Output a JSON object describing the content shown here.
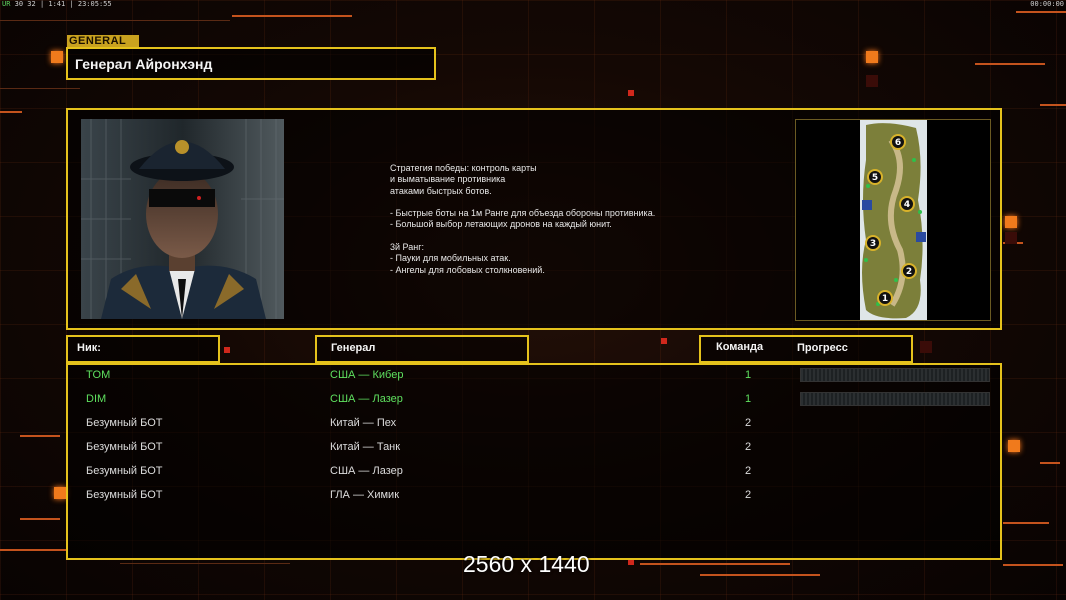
{
  "hud": {
    "top_left_ur": "UR",
    "top_left_rest": "30 32 | 1:41 | 23:05:55",
    "top_right": "00:00:00"
  },
  "general": {
    "tag": "GENERAL",
    "name": "Генерал Айронхэнд",
    "portrait_icon": "general-portrait",
    "description": [
      "Стратегия победы: контроль карты",
      "и выматывание противника",
      "атаками быстрых ботов.",
      "",
      "- Быстрые боты на 1м Ранге для объезда обороны противника.",
      "- Большой выбор летающих дронов на каждый юнит.",
      "",
      "3й Ранг:",
      "- Пауки для мобильных атак.",
      "- Ангелы для лобовых столкновений."
    ],
    "map_slots": [
      "6",
      "5",
      "4",
      "3",
      "2",
      "1"
    ]
  },
  "table": {
    "headers": {
      "nick": "Ник:",
      "general": "Генерал",
      "team": "Команда",
      "progress": "Прогресс"
    },
    "rows": [
      {
        "nick": "TOM",
        "general": "США — Кибер",
        "team": "1"
      },
      {
        "nick": "DIM",
        "general": "США — Лазер",
        "team": "1"
      },
      {
        "nick": "Безумный БОТ",
        "general": "Китай — Пех",
        "team": "2"
      },
      {
        "nick": "Безумный БОТ",
        "general": "Китай — Танк",
        "team": "2"
      },
      {
        "nick": "Безумный БОТ",
        "general": "США — Лазер",
        "team": "2"
      },
      {
        "nick": "Безумный БОТ",
        "general": "ГЛА — Химик",
        "team": "2"
      }
    ]
  },
  "resolution_label": "2560 x 1440",
  "colors": {
    "accent": "#e5c21c",
    "human_player": "#5fe05f",
    "bot_player": "#dcdcdc",
    "background": "#0b0503",
    "orange": "#f07a1c"
  }
}
